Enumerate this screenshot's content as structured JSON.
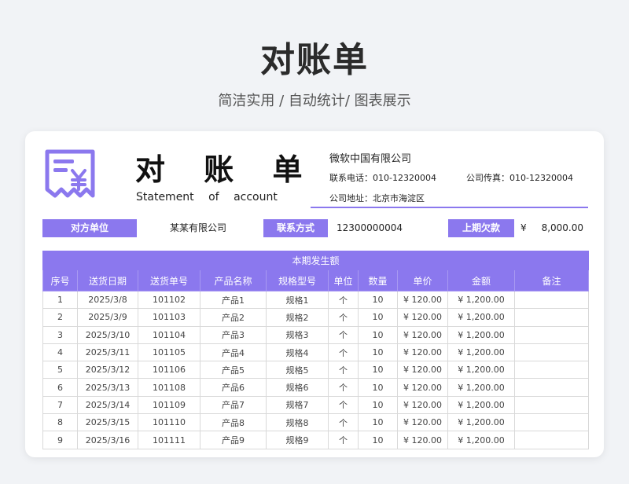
{
  "page": {
    "title": "对账单",
    "subtitle": "简洁实用 / 自动统计/ 图表展示"
  },
  "doc": {
    "title": "对 账 单",
    "subtitle": "Statement of account"
  },
  "company": {
    "name": "微软中国有限公司",
    "phone": "联系电话：010-12320004",
    "fax": "公司传真：010-12320004",
    "address": "公司地址：北京市海淀区"
  },
  "info": {
    "counterparty_label": "对方单位",
    "counterparty_value": "某某有限公司",
    "contact_label": "联系方式",
    "contact_value": "12300000004",
    "balance_label": "上期欠款",
    "balance_currency": "¥",
    "balance_value": "8,000.00"
  },
  "ledger": {
    "section_title": "本期发生额",
    "columns": [
      "序号",
      "送货日期",
      "送货单号",
      "产品名称",
      "规格型号",
      "单位",
      "数量",
      "单价",
      "金额",
      "备注"
    ],
    "rows": [
      [
        "1",
        "2025/3/8",
        "101102",
        "产品1",
        "规格1",
        "个",
        "10",
        "¥ 120.00",
        "¥ 1,200.00",
        ""
      ],
      [
        "2",
        "2025/3/9",
        "101103",
        "产品2",
        "规格2",
        "个",
        "10",
        "¥ 120.00",
        "¥ 1,200.00",
        ""
      ],
      [
        "3",
        "2025/3/10",
        "101104",
        "产品3",
        "规格3",
        "个",
        "10",
        "¥ 120.00",
        "¥ 1,200.00",
        ""
      ],
      [
        "4",
        "2025/3/11",
        "101105",
        "产品4",
        "规格4",
        "个",
        "10",
        "¥ 120.00",
        "¥ 1,200.00",
        ""
      ],
      [
        "5",
        "2025/3/12",
        "101106",
        "产品5",
        "规格5",
        "个",
        "10",
        "¥ 120.00",
        "¥ 1,200.00",
        ""
      ],
      [
        "6",
        "2025/3/13",
        "101108",
        "产品6",
        "规格6",
        "个",
        "10",
        "¥ 120.00",
        "¥ 1,200.00",
        ""
      ],
      [
        "7",
        "2025/3/14",
        "101109",
        "产品7",
        "规格7",
        "个",
        "10",
        "¥ 120.00",
        "¥ 1,200.00",
        ""
      ],
      [
        "8",
        "2025/3/15",
        "101110",
        "产品8",
        "规格8",
        "个",
        "10",
        "¥ 120.00",
        "¥ 1,200.00",
        ""
      ],
      [
        "9",
        "2025/3/16",
        "101111",
        "产品9",
        "规格9",
        "个",
        "10",
        "¥ 120.00",
        "¥ 1,200.00",
        ""
      ]
    ]
  },
  "colors": {
    "accent": "#8b78ee",
    "background": "#f1f3f6"
  },
  "icons": {
    "logo": "receipt-yen-icon"
  }
}
